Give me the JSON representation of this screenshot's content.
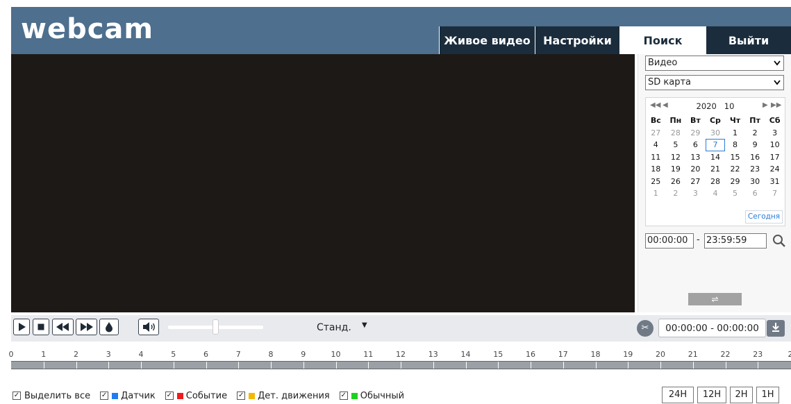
{
  "header": {
    "logo": "webcam",
    "tabs": [
      {
        "label": "Живое видео",
        "active": false
      },
      {
        "label": "Настройки",
        "active": false
      },
      {
        "label": "Поиск",
        "active": true
      },
      {
        "label": "Выйти",
        "active": false
      }
    ]
  },
  "search_panel": {
    "type_select": "Видео",
    "source_select": "SD карта",
    "calendar": {
      "year": "2020",
      "month": "10",
      "weekdays": [
        "Вс",
        "Пн",
        "Вт",
        "Ср",
        "Чт",
        "Пт",
        "Сб"
      ],
      "weeks": [
        [
          "27",
          "28",
          "29",
          "30",
          "1",
          "2",
          "3"
        ],
        [
          "4",
          "5",
          "6",
          "7",
          "8",
          "9",
          "10"
        ],
        [
          "11",
          "12",
          "13",
          "14",
          "15",
          "16",
          "17"
        ],
        [
          "18",
          "19",
          "20",
          "21",
          "22",
          "23",
          "24"
        ],
        [
          "25",
          "26",
          "27",
          "28",
          "29",
          "30",
          "31"
        ],
        [
          "1",
          "2",
          "3",
          "4",
          "5",
          "6",
          "7"
        ]
      ],
      "selected_day": "7",
      "today_label": "Сегодня"
    },
    "start_time": "00:00:00",
    "time_separator": "-",
    "end_time": "23:59:59"
  },
  "playback": {
    "speed": "Станд.",
    "clip_range": "00:00:00 - 00:00:00"
  },
  "timeline": {
    "hours": [
      "0",
      "1",
      "2",
      "3",
      "4",
      "5",
      "6",
      "7",
      "8",
      "9",
      "10",
      "11",
      "12",
      "13",
      "14",
      "15",
      "16",
      "17",
      "18",
      "19",
      "20",
      "21",
      "22",
      "23",
      "2"
    ]
  },
  "legend": [
    {
      "label": "Выделить все",
      "color": null
    },
    {
      "label": "Датчик",
      "color": "#1e7ef0"
    },
    {
      "label": "Событие",
      "color": "#ee1c1c"
    },
    {
      "label": "Дет. движения",
      "color": "#f5b700"
    },
    {
      "label": "Обычный",
      "color": "#1fd11f"
    }
  ],
  "zoom": [
    "24H",
    "12H",
    "2H",
    "1H"
  ],
  "colors": {
    "header_bg": "#4e6f8d",
    "tab_bg": "#1b2d3d",
    "video_bg": "#1d1916",
    "accent": "#2a7ad8"
  },
  "icons": {
    "play": "play-icon",
    "stop": "stop-icon",
    "rewind": "rewind-icon",
    "forward": "fast-forward-icon",
    "snapshot": "water-drop-icon",
    "volume": "volume-icon",
    "search": "search-icon",
    "swap": "swap-arrows-icon",
    "scissors": "scissors-icon",
    "download": "download-icon"
  }
}
